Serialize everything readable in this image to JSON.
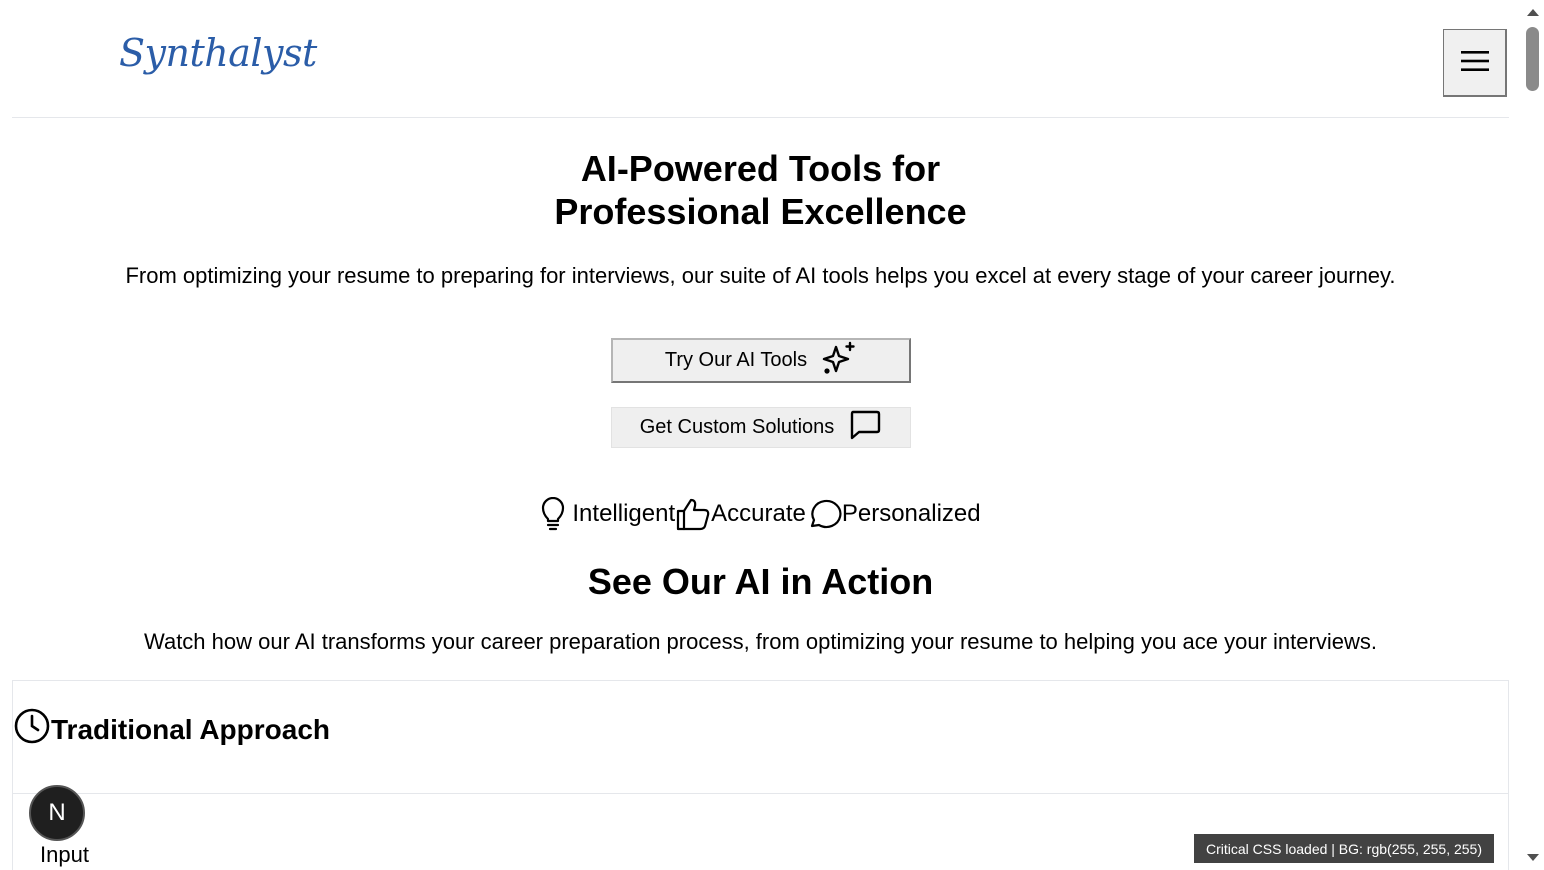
{
  "header": {
    "logo_text": "Synthalyst",
    "menu_icon": "hamburger-menu-icon"
  },
  "hero": {
    "title_line1": "AI-Powered Tools for",
    "title_line2": "Professional Excellence",
    "subtitle": "From optimizing your resume to preparing for interviews, our suite of AI tools helps you excel at every stage of your career journey.",
    "primary_button_label": "Try Our AI Tools",
    "primary_button_icon": "sparkles-icon",
    "secondary_button_label": "Get Custom Solutions",
    "secondary_button_icon": "message-square-icon"
  },
  "features": [
    {
      "label": "Intelligent",
      "icon": "lightbulb-icon"
    },
    {
      "label": "Accurate",
      "icon": "thumbs-up-icon"
    },
    {
      "label": "Personalized",
      "icon": "message-circle-icon"
    }
  ],
  "action_section": {
    "title": "See Our AI in Action",
    "subtitle": "Watch how our AI transforms your career preparation process, from optimizing your resume to helping you ace your interviews."
  },
  "comparison_panel": {
    "title": "Traditional Approach",
    "icon": "clock-icon"
  },
  "dev_badge": {
    "letter": "N",
    "label": "Input"
  },
  "status_toast": {
    "text": "Critical CSS loaded | BG: rgb(255, 255, 255)"
  },
  "colors": {
    "logo": "#2b5da8",
    "button_bg": "#efefef",
    "toast_bg": "#282828"
  }
}
